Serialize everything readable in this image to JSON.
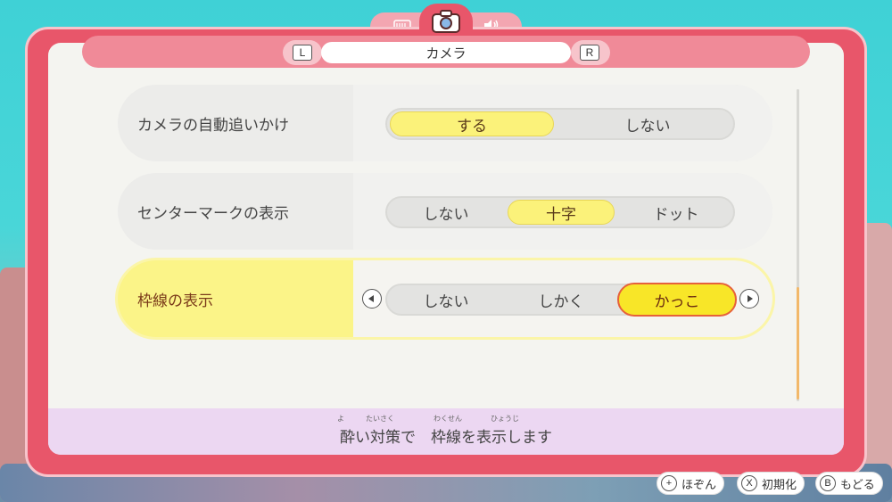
{
  "tabs": {
    "left_icon": "controller-icon",
    "center_icon": "camera-icon",
    "right_icon": "speaker-icon"
  },
  "header": {
    "prev_key": "L",
    "next_key": "R",
    "title": "カメラ"
  },
  "settings": [
    {
      "label": "カメラの自動追いかけ",
      "options": [
        "する",
        "しない"
      ],
      "selected": "する"
    },
    {
      "label": "センターマークの表示",
      "options": [
        "しない",
        "十字",
        "ドット"
      ],
      "selected": "十字"
    },
    {
      "label": "枠線の表示",
      "options": [
        "しない",
        "しかく",
        "かっこ"
      ],
      "selected": "かっこ"
    }
  ],
  "description": {
    "text": "酔い対策で　枠線を表示します",
    "ruby": [
      "よ",
      "たいさく",
      "わくせん",
      "ひょうじ"
    ]
  },
  "footer": {
    "save": {
      "key": "+",
      "label": "ほぞん"
    },
    "reset": {
      "key": "X",
      "label": "初期化"
    },
    "back": {
      "key": "B",
      "label": "もどる"
    }
  },
  "colors": {
    "frame": "#e8566a",
    "selected": "#fbf27a",
    "active_row": "#fbf488"
  }
}
